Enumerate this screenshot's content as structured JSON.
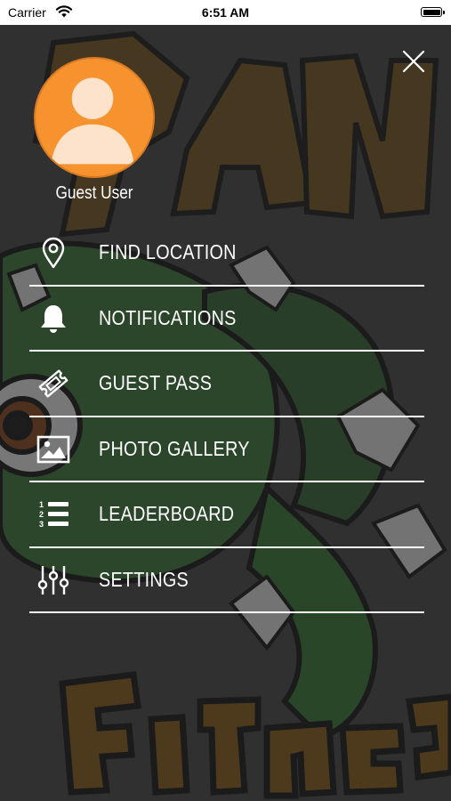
{
  "status_bar": {
    "carrier": "Carrier",
    "time": "6:51 AM"
  },
  "user": {
    "name": "Guest User"
  },
  "menu": {
    "items": [
      {
        "label": "FIND LOCATION",
        "icon": "location-pin-icon"
      },
      {
        "label": "NOTIFICATIONS",
        "icon": "bell-icon"
      },
      {
        "label": "GUEST PASS",
        "icon": "ticket-icon"
      },
      {
        "label": "PHOTO GALLERY",
        "icon": "image-icon"
      },
      {
        "label": "LEADERBOARD",
        "icon": "numbered-list-icon"
      },
      {
        "label": "SETTINGS",
        "icon": "sliders-icon"
      }
    ]
  },
  "colors": {
    "accent": "#f7932e",
    "text": "#ffffff",
    "overlay": "#2b2b2b"
  }
}
